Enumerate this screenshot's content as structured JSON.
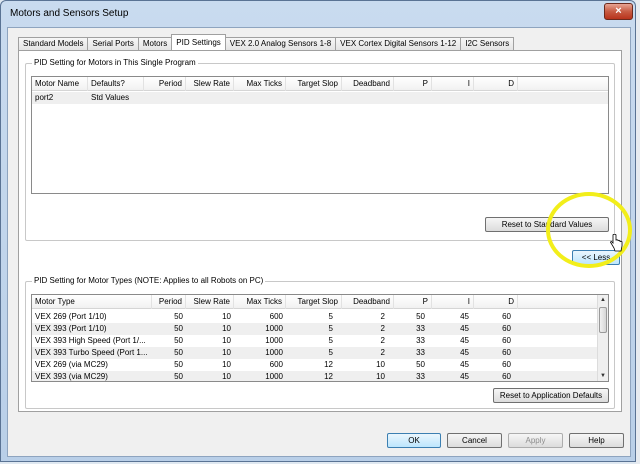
{
  "window": {
    "title": "Motors and Sensors Setup",
    "close_glyph": "×"
  },
  "tabs": [
    {
      "label": "Standard Models"
    },
    {
      "label": "Serial Ports"
    },
    {
      "label": "Motors"
    },
    {
      "label": "PID Settings"
    },
    {
      "label": "VEX 2.0 Analog Sensors 1-8"
    },
    {
      "label": "VEX Cortex Digital Sensors 1-12"
    },
    {
      "label": "I2C Sensors"
    }
  ],
  "motors_group": {
    "title": "PID Setting for Motors in This Single Program",
    "columns": [
      "Motor Name",
      "Defaults?",
      "Period",
      "Slew Rate",
      "Max Ticks",
      "Target Slop",
      "Deadband",
      "P",
      "I",
      "D"
    ],
    "rows": [
      {
        "name": "port2",
        "defaults": "Std Values"
      }
    ],
    "reset_label": "Reset to Standard Values"
  },
  "less_button": {
    "label": "<< Less"
  },
  "types_group": {
    "title": "PID Setting for Motor Types (NOTE: Applies to all Robots on PC)",
    "columns": [
      "Motor Type",
      "Period",
      "Slew Rate",
      "Max Ticks",
      "Target Slop",
      "Deadband",
      "P",
      "I",
      "D"
    ],
    "rows": [
      {
        "type": "VEX 269 (Port 1/10)",
        "period": "50",
        "slew": "10",
        "ticks": "600",
        "slop": "5",
        "deadband": "2",
        "p": "50",
        "i": "45",
        "d": "60"
      },
      {
        "type": "VEX 393 (Port 1/10)",
        "period": "50",
        "slew": "10",
        "ticks": "1000",
        "slop": "5",
        "deadband": "2",
        "p": "33",
        "i": "45",
        "d": "60"
      },
      {
        "type": "VEX 393 High Speed (Port 1/...",
        "period": "50",
        "slew": "10",
        "ticks": "1000",
        "slop": "5",
        "deadband": "2",
        "p": "33",
        "i": "45",
        "d": "60"
      },
      {
        "type": "VEX 393 Turbo Speed (Port 1...",
        "period": "50",
        "slew": "10",
        "ticks": "1000",
        "slop": "5",
        "deadband": "2",
        "p": "33",
        "i": "45",
        "d": "60"
      },
      {
        "type": "VEX 269 (via MC29)",
        "period": "50",
        "slew": "10",
        "ticks": "600",
        "slop": "12",
        "deadband": "10",
        "p": "50",
        "i": "45",
        "d": "60"
      },
      {
        "type": "VEX 393 (via MC29)",
        "period": "50",
        "slew": "10",
        "ticks": "1000",
        "slop": "12",
        "deadband": "10",
        "p": "33",
        "i": "45",
        "d": "60"
      }
    ],
    "reset_label": "Reset to Application Defaults"
  },
  "footer": {
    "ok": "OK",
    "cancel": "Cancel",
    "apply": "Apply",
    "help": "Help"
  },
  "icons": {
    "scroll_up": "▲",
    "scroll_down": "▼"
  },
  "colors": {
    "highlight_ring": "#f2ee1a"
  }
}
